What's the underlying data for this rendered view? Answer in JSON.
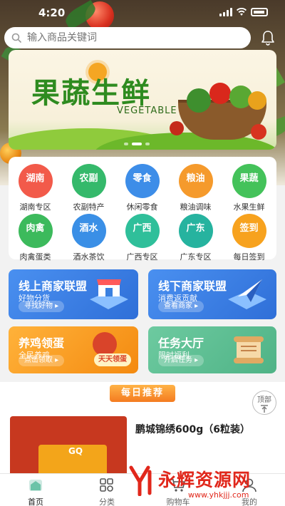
{
  "status_bar": {
    "time": "4:20"
  },
  "search": {
    "placeholder": "输入商品关键词"
  },
  "banner": {
    "title": "果蔬生鲜",
    "subtitle": "VEGETABLE",
    "slide_count": 3,
    "active_slide": 2
  },
  "categories": [
    {
      "badge": "湖南",
      "label": "湖南专区",
      "color": "#f25a4a"
    },
    {
      "badge": "农副",
      "label": "农副特产",
      "color": "#35b96b"
    },
    {
      "badge": "零食",
      "label": "休闲零食",
      "color": "#3d8de8"
    },
    {
      "badge": "粮油",
      "label": "粮油调味",
      "color": "#f59a2c"
    },
    {
      "badge": "果蔬",
      "label": "水果生鲜",
      "color": "#44c25a"
    },
    {
      "badge": "肉禽",
      "label": "肉禽蛋类",
      "color": "#3cba5c"
    },
    {
      "badge": "酒水",
      "label": "酒水茶饮",
      "color": "#3a8fe6"
    },
    {
      "badge": "广西",
      "label": "广西专区",
      "color": "#2fbf9a"
    },
    {
      "badge": "广东",
      "label": "广东专区",
      "color": "#26b39f"
    },
    {
      "badge": "签到",
      "label": "每日签到",
      "color": "#f7a21e"
    }
  ],
  "promos": {
    "online": {
      "title": "线上商家联盟",
      "subtitle": "好物分货",
      "button": "寻找好物 ▸",
      "color": "#3a80e0"
    },
    "offline": {
      "title": "线下商家联盟",
      "subtitle": "消费返贡献",
      "button": "查看商家 ▸",
      "color": "#3a80e0"
    },
    "chicken": {
      "title": "养鸡领蛋",
      "subtitle": "全民养鸡",
      "button": "点击领取 ▸",
      "tag": "天天领蛋",
      "color": "#f6a01a"
    },
    "tasks": {
      "title": "任务大厅",
      "subtitle": "限时福利",
      "button": "开启任务 ▸",
      "color": "#5fbf94"
    }
  },
  "daily": {
    "title": "每日推荐",
    "back_to_top": "顶部",
    "product": {
      "name": "鹏城锦绣600g（6粒装）",
      "brand": "GQ"
    }
  },
  "nav": [
    {
      "label": "首页",
      "icon": "home-icon",
      "active": true
    },
    {
      "label": "分类",
      "icon": "category-icon",
      "active": false
    },
    {
      "label": "购物车",
      "icon": "cart-icon",
      "active": false
    },
    {
      "label": "我的",
      "icon": "user-icon",
      "active": false
    }
  ],
  "watermark": {
    "text": "永辉资源网",
    "url": "www.yhkjjj.com"
  }
}
